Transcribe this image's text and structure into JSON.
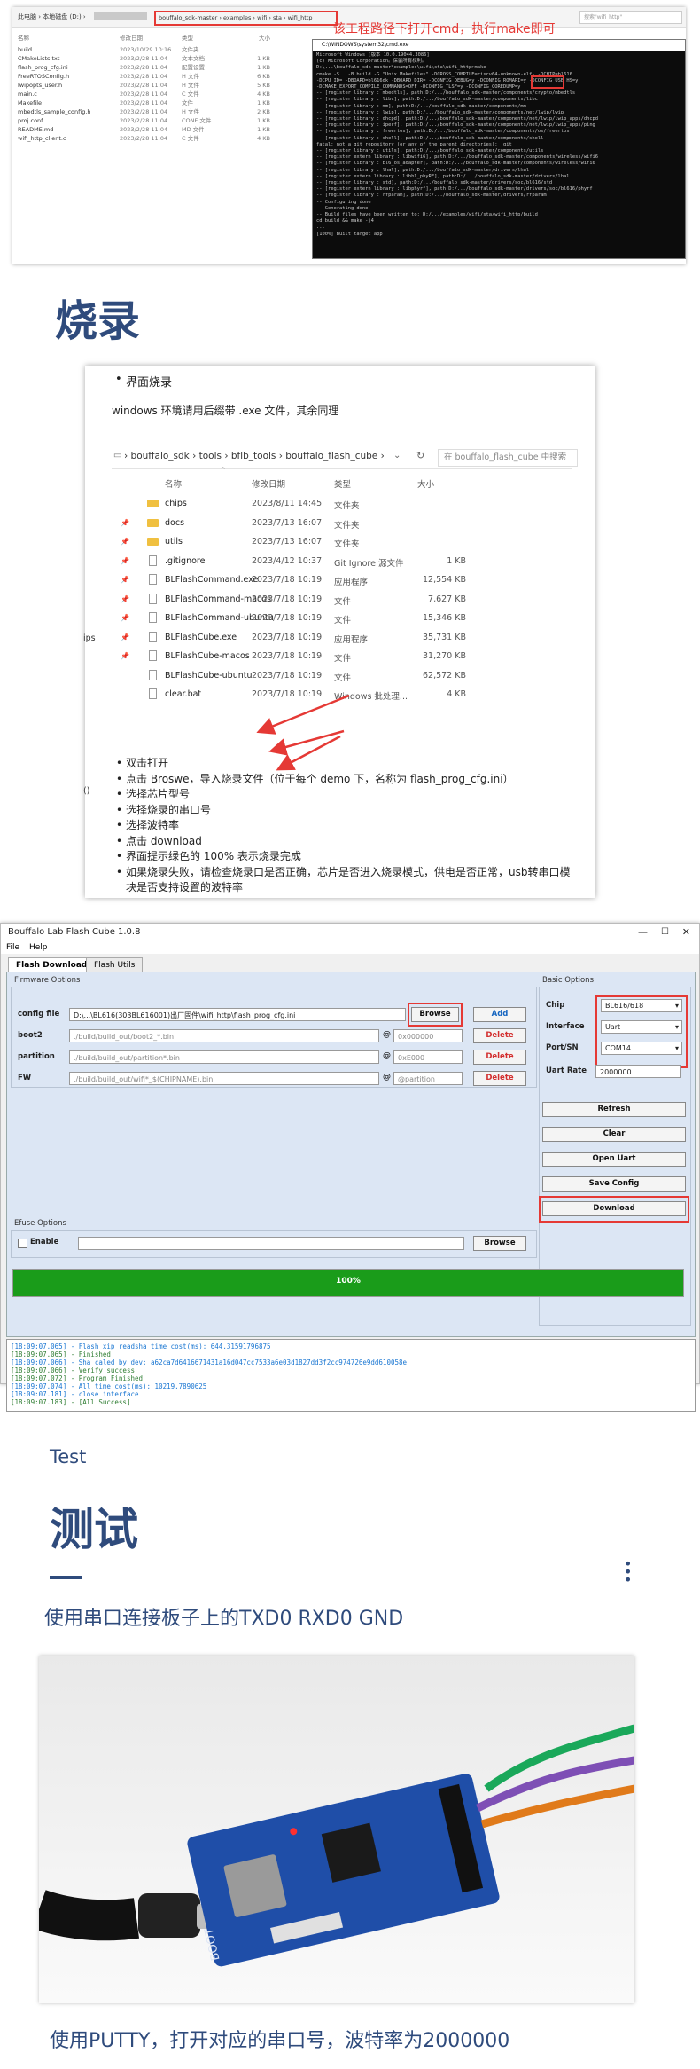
{
  "top_section": {
    "explorer": {
      "breadcrumb_left": "此电脑 › 本地磁盘 (D:) ›",
      "address_path": "bouffalo_sdk-master › examples › wifi › sta › wifi_http",
      "search_placeholder": "搜索\"wifi_http\"",
      "columns": [
        "名称",
        "修改日期",
        "类型",
        "大小"
      ],
      "files": [
        {
          "name": "build",
          "date": "2023/10/29 10:16",
          "type": "文件夹",
          "size": ""
        },
        {
          "name": "CMakeLists.txt",
          "date": "2023/2/28 11:04",
          "type": "文本文档",
          "size": "1 KB"
        },
        {
          "name": "flash_prog_cfg.ini",
          "date": "2023/2/28 11:04",
          "type": "配置设置",
          "size": "1 KB"
        },
        {
          "name": "FreeRTOSConfig.h",
          "date": "2023/2/28 11:04",
          "type": "H 文件",
          "size": "6 KB"
        },
        {
          "name": "lwipopts_user.h",
          "date": "2023/2/28 11:04",
          "type": "H 文件",
          "size": "5 KB"
        },
        {
          "name": "main.c",
          "date": "2023/2/28 11:04",
          "type": "C 文件",
          "size": "4 KB"
        },
        {
          "name": "Makefile",
          "date": "2023/2/28 11:04",
          "type": "文件",
          "size": "1 KB"
        },
        {
          "name": "mbedtls_sample_config.h",
          "date": "2023/2/28 11:04",
          "type": "H 文件",
          "size": "2 KB"
        },
        {
          "name": "proj.conf",
          "date": "2023/2/28 11:04",
          "type": "CONF 文件",
          "size": "1 KB"
        },
        {
          "name": "README.md",
          "date": "2023/2/28 11:04",
          "type": "MD 文件",
          "size": "1 KB"
        },
        {
          "name": "wifi_http_client.c",
          "date": "2023/2/28 11:04",
          "type": "C 文件",
          "size": "4 KB"
        }
      ]
    },
    "annotation": "该工程路径下打开cmd，执行make即可",
    "cmd": {
      "title": "C:\\WINDOWS\\system32\\cmd.exe",
      "lines": [
        "Microsoft Windows [版本 10.0.19044.3086]",
        "(c) Microsoft Corporation。保留所有权利。",
        "",
        "D:\\...\\bouffalo_sdk-master\\examples\\wifi\\sta\\wifi_http>make",
        "cmake -S . -B build -G \"Unix Makefiles\" -DCROSS_COMPILE=riscv64-unknown-elf- -DCHIP=bl616",
        "-DCPU_ID= -DBOARD=bl616dk -DBOARD_DIR= -DCONFIG_DEBUG=y -DCONFIG_ROMAPI=y -DCONFIG_USB_HS=y",
        "-DCMAKE_EXPORT_COMPILE_COMMANDS=OFF -DCONFIG_TLSF=y -DCONFIG_COREDUMP=y",
        "-- [register library : mbedtls], path:D:/.../bouffalo_sdk-master/components/crypto/mbedtls",
        "-- [register library : libc], path:D:/.../bouffalo_sdk-master/components/libc",
        "-- [register library : mm], path:D:/.../bouffalo_sdk-master/components/mm",
        "-- [register library : lwip], path:D:/.../bouffalo_sdk-master/components/net/lwip/lwip",
        "-- [register library : dhcpd], path:D:/.../bouffalo_sdk-master/components/net/lwip/lwip_apps/dhcpd",
        "-- [register library : iperf], path:D:/.../bouffalo_sdk-master/components/net/lwip/lwip_apps/ping",
        "-- [register library : freertos], path:D:/.../bouffalo_sdk-master/components/os/freertos",
        "-- [register library : shell], path:D:/.../bouffalo_sdk-master/components/shell",
        "fatal: not a git repository (or any of the parent directories): .git",
        "-- [register library : utils], path:D:/.../bouffalo_sdk-master/components/utils",
        "-- [register extern library : libwifi6], path:D:/.../bouffalo_sdk-master/components/wireless/wifi6",
        "-- [register library : bl6_os_adapter], path:D:/.../bouffalo_sdk-master/components/wireless/wifi6",
        "-- [register library : lhal], path:D:/.../bouffalo_sdk-master/drivers/lhal",
        "-- [register extern library : libbl_phyRF], path:D:/.../bouffalo_sdk-master/drivers/lhal",
        "-- [register library : std], path:D:/.../bouffalo_sdk-master/drivers/soc/bl616/std",
        "-- [register extern library : libphyrf], path:D:/.../bouffalo_sdk-master/drivers/soc/bl616/phyrf",
        "-- [register library : rfparam], path:D:/.../bouffalo_sdk-master/drivers/rfparam",
        "-- Configuring done",
        "-- Generating done",
        "-- Build files have been written to: D:/.../examples/wifi/sta/wifi_http/build",
        "cd build && make -j4",
        "...",
        "[100%] Built target app"
      ]
    }
  },
  "burn_section": {
    "title": "烧录",
    "bullet_top": "界面烧录",
    "intro": "windows 环境请用后缀带 .exe 文件，其余同理",
    "explorer": {
      "breadcrumb": "› bouffalo_sdk › tools › bflb_tools › bouffalo_flash_cube ›",
      "search_placeholder": "在 bouffalo_flash_cube 中搜索",
      "columns": [
        "名称",
        "修改日期",
        "类型",
        "大小"
      ],
      "side_label": "ips",
      "side_label2": "()",
      "files": [
        {
          "name": "chips",
          "date": "2023/8/11 14:45",
          "type": "文件夹",
          "size": "",
          "kind": "folder"
        },
        {
          "name": "docs",
          "date": "2023/7/13 16:07",
          "type": "文件夹",
          "size": "",
          "kind": "folder"
        },
        {
          "name": "utils",
          "date": "2023/7/13 16:07",
          "type": "文件夹",
          "size": "",
          "kind": "folder"
        },
        {
          "name": ".gitignore",
          "date": "2023/4/12 10:37",
          "type": "Git Ignore 源文件",
          "size": "1 KB",
          "kind": "file"
        },
        {
          "name": "BLFlashCommand.exe",
          "date": "2023/7/18 10:19",
          "type": "应用程序",
          "size": "12,554 KB",
          "kind": "file"
        },
        {
          "name": "BLFlashCommand-macos",
          "date": "2023/7/18 10:19",
          "type": "文件",
          "size": "7,627 KB",
          "kind": "file"
        },
        {
          "name": "BLFlashCommand-ubuntu",
          "date": "2023/7/18 10:19",
          "type": "文件",
          "size": "15,346 KB",
          "kind": "file"
        },
        {
          "name": "BLFlashCube.exe",
          "date": "2023/7/18 10:19",
          "type": "应用程序",
          "size": "35,731 KB",
          "kind": "file"
        },
        {
          "name": "BLFlashCube-macos",
          "date": "2023/7/18 10:19",
          "type": "文件",
          "size": "31,270 KB",
          "kind": "file"
        },
        {
          "name": "BLFlashCube-ubuntu",
          "date": "2023/7/18 10:19",
          "type": "文件",
          "size": "62,572 KB",
          "kind": "file"
        },
        {
          "name": "clear.bat",
          "date": "2023/7/18 10:19",
          "type": "Windows 批处理...",
          "size": "4 KB",
          "kind": "file"
        }
      ]
    },
    "steps": [
      "双击打开",
      "点击 Broswe，导入烧录文件（位于每个 demo 下，名称为 flash_prog_cfg.ini）",
      "选择芯片型号",
      "选择烧录的串口号",
      "选择波特率",
      "点击 download",
      "界面提示绿色的 100% 表示烧录完成",
      "如果烧录失败，请检查烧录口是否正确，芯片是否进入烧录模式，供电是否正常，usb转串口模",
      "块是否支持设置的波特率"
    ]
  },
  "flash_cube": {
    "window_title": "Bouffalo Lab Flash Cube 1.0.8",
    "menu": [
      "File",
      "Help"
    ],
    "tabs": [
      "Flash Download",
      "Flash Utils"
    ],
    "firmware_options_label": "Firmware Options",
    "basic_options_label": "Basic Options",
    "rows": [
      {
        "label": "config file",
        "value": "D:\\...\\BL616(303BL616001)出厂固件\\wifi_http\\flash_prog_cfg.ini",
        "addr": "",
        "action": "Add",
        "browse": "Browse"
      },
      {
        "label": "boot2",
        "value": "./build/build_out/boot2_*.bin",
        "addr": "0x000000",
        "action": "Delete",
        "browse": ""
      },
      {
        "label": "partition",
        "value": "./build/build_out/partition*.bin",
        "addr": "0xE000",
        "action": "Delete",
        "browse": ""
      },
      {
        "label": "FW",
        "value": "./build/build_out/wifi*_$(CHIPNAME).bin",
        "addr": "@partition",
        "action": "Delete",
        "browse": ""
      }
    ],
    "efuse_label": "Efuse Options",
    "enable_label": "Enable",
    "efuse_browse": "Browse",
    "progress": "100%",
    "progress_value": 1.0,
    "basic": {
      "chip_label": "Chip",
      "chip_value": "BL616/618",
      "interface_label": "Interface",
      "interface_value": "Uart",
      "port_label": "Port/SN",
      "port_value": "COM14",
      "baud_label": "Uart Rate",
      "baud_value": "2000000"
    },
    "buttons": [
      "Refresh",
      "Clear",
      "Open Uart",
      "Save Config",
      "Download"
    ],
    "log": [
      "[18:09:07.065] - Flash xip readsha time cost(ms): 644.31591796875",
      "[18:09:07.065] - Finished",
      "[18:09:07.066] - Sha caled by dev: a62ca7d6416671431a16d047cc7533a6e03d1827dd3f2cc974726e9dd610058e",
      "[18:09:07.066] - Verify success",
      "[18:09:07.072] - Program Finished",
      "[18:09:07.074] - All time cost(ms): 10219.7890625",
      "[18:09:07.181] - close interface",
      "[18:09:07.183] - [All Success]"
    ],
    "colors": {
      "progress": "#1a9c1a",
      "log_text": "#1976d2",
      "highlight": "#e53935"
    }
  },
  "test_section": {
    "eyebrow": "Test",
    "title": "测试",
    "line1": "使用串口连接板子上的TXD0 RXD0 GND",
    "board_label": "BOOT",
    "line2": "使用PUTTY，打开对应的串口号，波特率为2000000"
  }
}
